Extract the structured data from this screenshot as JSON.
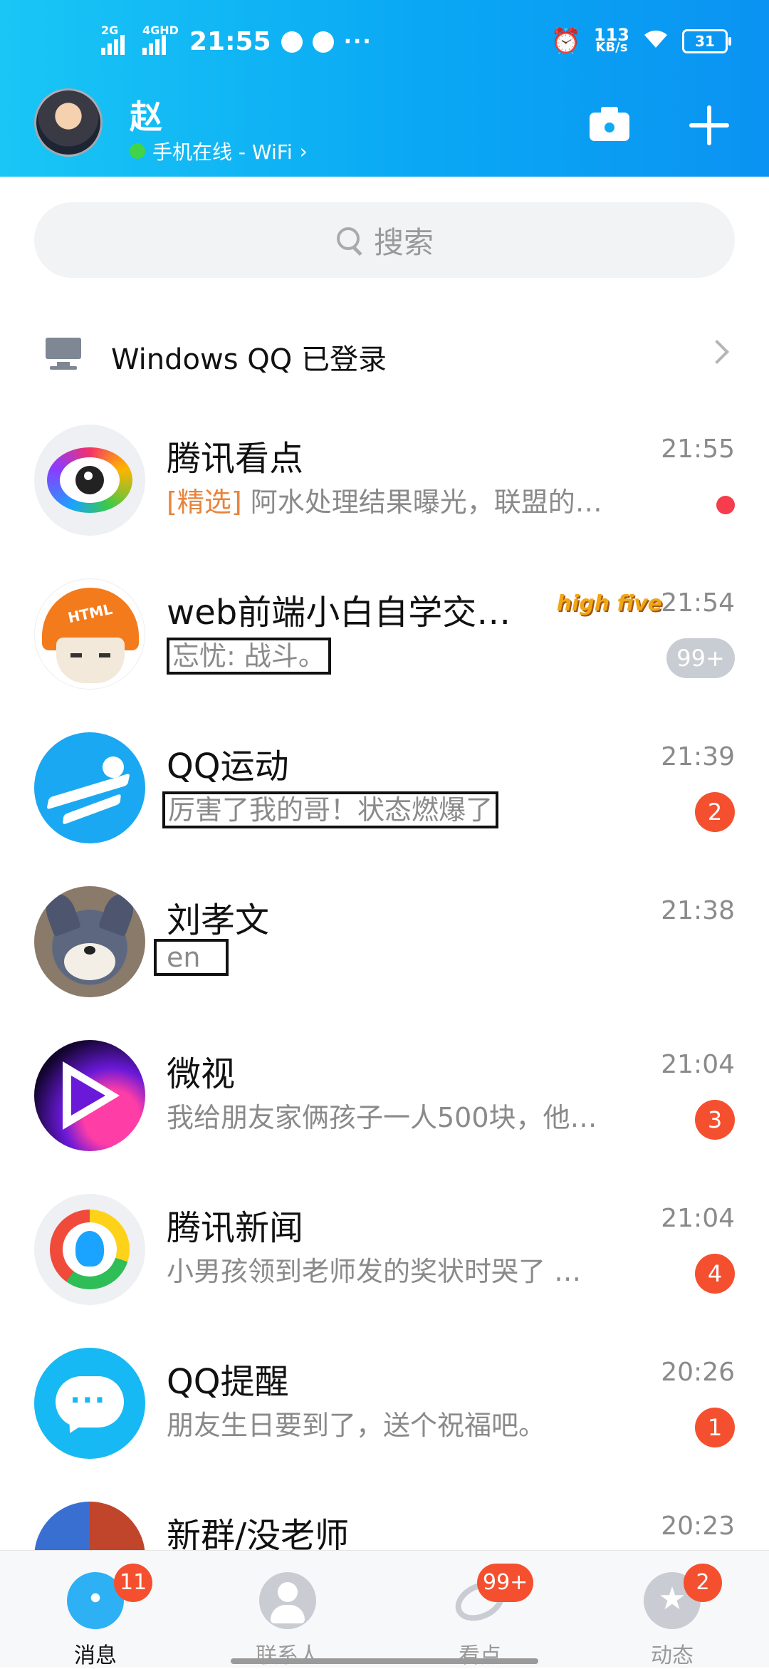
{
  "status_bar": {
    "sim1": "2G",
    "sim2": "4GHD",
    "time": "21:55",
    "extra_dots": "···",
    "speed_value": "113",
    "speed_unit": "KB/s",
    "battery": "31"
  },
  "header": {
    "user_name": "赵",
    "online_status": "手机在线 - WiFi",
    "chevron": "›"
  },
  "search": {
    "placeholder": "搜索"
  },
  "windows_login": {
    "text": "Windows QQ 已登录"
  },
  "conversations": [
    {
      "name": "腾讯看点",
      "time": "21:55",
      "tag": "[精选]",
      "message": " 阿水处理结果曝光，联盟的…",
      "indicator": "dot",
      "avatar": "kandian-eye-icon"
    },
    {
      "name": "web前端小白自学交…",
      "time": "21:54",
      "message": "忘忧: 战斗。",
      "badge": "99+",
      "sticker": "high five",
      "avatar": "helmet-avatar"
    },
    {
      "name": "QQ运动",
      "time": "21:39",
      "message": "厉害了我的哥！状态燃爆了",
      "badge": "2",
      "avatar": "runner-icon"
    },
    {
      "name": "刘孝文",
      "time": "21:38",
      "message": "en",
      "badge": "",
      "avatar": "tom-cat-avatar"
    },
    {
      "name": "微视",
      "time": "21:04",
      "message": "我给朋友家俩孩子一人500块，他…",
      "badge": "3",
      "avatar": "weishi-play-icon"
    },
    {
      "name": "腾讯新闻",
      "time": "21:04",
      "message": "小男孩领到老师发的奖状时哭了 …",
      "badge": "4",
      "avatar": "tencent-news-icon"
    },
    {
      "name": "QQ提醒",
      "time": "20:26",
      "message": "朋友生日要到了，送个祝福吧。",
      "badge": "1",
      "avatar": "chat-bubble-icon"
    },
    {
      "name": "新群/没老师",
      "time": "20:23",
      "message": "",
      "badge": "",
      "avatar": "group-avatar"
    }
  ],
  "tabs": [
    {
      "label": "消息",
      "badge": "11",
      "icon": "messages-icon",
      "active": true
    },
    {
      "label": "联系人",
      "badge": "",
      "icon": "contacts-icon",
      "active": false
    },
    {
      "label": "看点",
      "badge": "99+",
      "icon": "kandian-icon",
      "active": false
    },
    {
      "label": "动态",
      "badge": "2",
      "icon": "feed-icon",
      "active": false
    }
  ],
  "colors": {
    "header_gradient_start": "#19c6f5",
    "header_gradient_end": "#0a93f2",
    "badge_red": "#f4502f",
    "tag_orange": "#e8843c",
    "online_green": "#3fd44a"
  }
}
